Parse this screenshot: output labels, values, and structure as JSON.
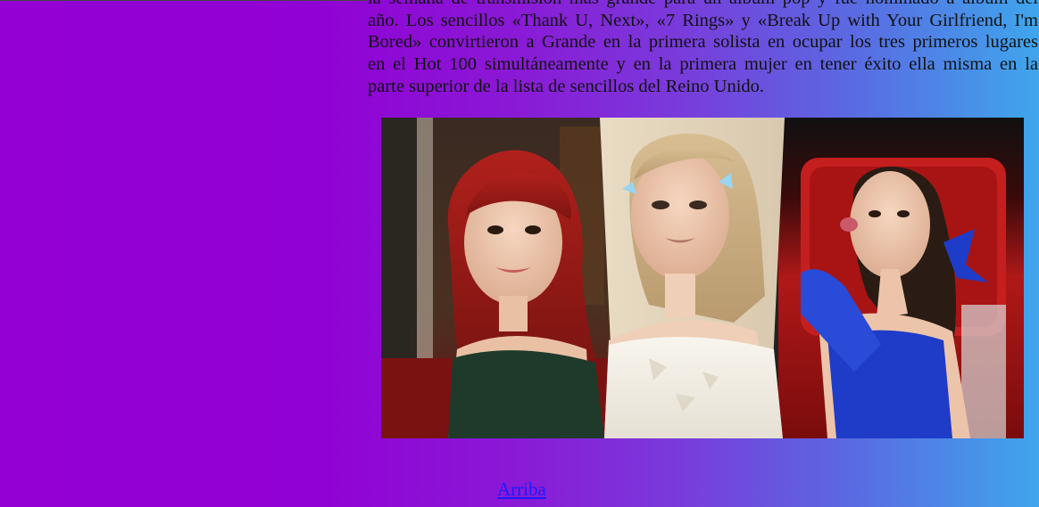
{
  "article": {
    "lines": [
      "la semana de transmisión más grande para un álbum pop y fue nominado a álbum del",
      "año. Los sencillos «Thank U, Next», «7 Rings» y «Break Up with Your Girlfriend, I'm",
      "Bored» convirtieron a Grande en la primera solista en ocupar los tres primeros lugares",
      "en el Hot 100 simultáneamente y en la primera mujer en tener éxito ella misma en la",
      "parte superior de la lista de sencillos del Reino Unido."
    ]
  },
  "photo": {
    "panels": [
      "red-carpet-portrait",
      "white-dress-portrait",
      "blue-dress-portrait"
    ]
  },
  "nav": {
    "top_link": "Arriba"
  },
  "colors": {
    "gradient_left": "#9400d3",
    "gradient_right": "#3fa6ec",
    "link": "#1a1aff"
  }
}
